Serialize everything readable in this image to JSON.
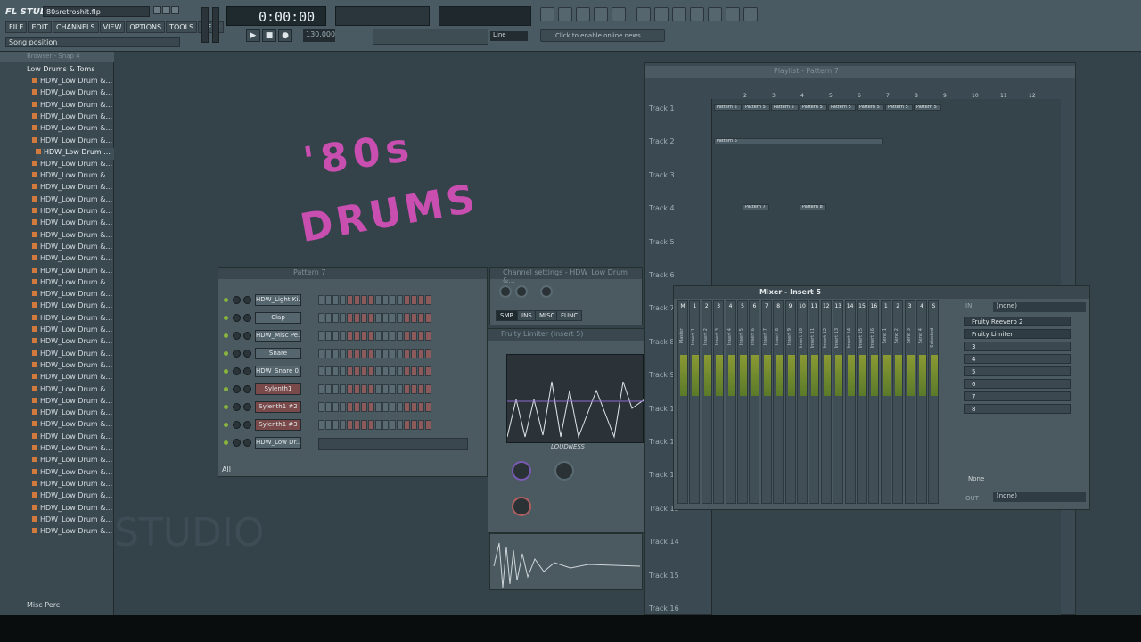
{
  "app": {
    "logo": "FL STUDIO",
    "project_file": "80sretroshit.flp",
    "hint": "Song position",
    "time": "0:00:00",
    "tempo": "130.000",
    "snap": "Line",
    "online": "Click to enable online news"
  },
  "menu": [
    "FILE",
    "EDIT",
    "CHANNELS",
    "VIEW",
    "OPTIONS",
    "TOOLS",
    "HELP"
  ],
  "browser": {
    "title": "Browser - Snap 4",
    "folder": "Low Drums & Toms",
    "selected": "HDW_Low Drum ...",
    "item_label": "HDW_Low Drum &...",
    "bottom_folder": "Misc Perc"
  },
  "overlay_text": {
    "line1": "'80s",
    "line2": "DRUMS",
    "watermark": "STUDIO"
  },
  "channel_rack": {
    "title": "Pattern 7",
    "filter": "All",
    "channels": [
      {
        "name": "HDW_Light Ki...",
        "red": false
      },
      {
        "name": "Clap",
        "red": false
      },
      {
        "name": "HDW_Misc Pe...",
        "red": false
      },
      {
        "name": "Snare",
        "red": false
      },
      {
        "name": "HDW_Snare 0...",
        "red": false
      },
      {
        "name": "Sylenth1",
        "red": true
      },
      {
        "name": "Sylenth1 #2",
        "red": true
      },
      {
        "name": "Sylenth1 #3",
        "red": true
      },
      {
        "name": "HDW_Low Dr...",
        "red": false
      }
    ]
  },
  "channel_settings": {
    "title": "Channel settings - HDW_Low Drum &...",
    "tabs": [
      "SMP",
      "INS",
      "MISC",
      "FUNC"
    ]
  },
  "limiter": {
    "title": "Fruity Limiter (Insert 5)",
    "mode_label": "LOUDNESS"
  },
  "playlist": {
    "title": "Playlist - Pattern 7",
    "tracks": [
      "Track 1",
      "Track 2",
      "Track 3",
      "Track 4",
      "Track 5",
      "Track 6",
      "Track 7",
      "Track 8",
      "Track 9",
      "Track 10",
      "Track 11",
      "Track 12",
      "Track 13",
      "Track 14",
      "Track 15",
      "Track 16"
    ],
    "ruler": [
      "2",
      "3",
      "4",
      "5",
      "6",
      "7",
      "8",
      "9",
      "10",
      "11",
      "12"
    ],
    "clip_pattern5": "Pattern 5",
    "clip_pattern6": "Pattern 6",
    "clip_pattern7": "Pattern 7",
    "clip_pattern8": "Pattern 8"
  },
  "mixer": {
    "title": "Mixer - Insert 5",
    "in_label": "IN",
    "out_label": "OUT",
    "in_value": "(none)",
    "out_value": "(none)",
    "slots": [
      "Fruity Reeverb 2",
      "Fruity Limiter",
      "3",
      "4",
      "5",
      "6",
      "7",
      "8"
    ],
    "none_label": "None",
    "strips": [
      {
        "num": "M",
        "name": "Master"
      },
      {
        "num": "1",
        "name": "Insert 1"
      },
      {
        "num": "2",
        "name": "Insert 2"
      },
      {
        "num": "3",
        "name": "Insert 3"
      },
      {
        "num": "4",
        "name": "Insert 4"
      },
      {
        "num": "5",
        "name": "Insert 5"
      },
      {
        "num": "6",
        "name": "Insert 6"
      },
      {
        "num": "7",
        "name": "Insert 7"
      },
      {
        "num": "8",
        "name": "Insert 8"
      },
      {
        "num": "9",
        "name": "Insert 9"
      },
      {
        "num": "10",
        "name": "Insert 10"
      },
      {
        "num": "11",
        "name": "Insert 11"
      },
      {
        "num": "12",
        "name": "Insert 12"
      },
      {
        "num": "13",
        "name": "Insert 13"
      },
      {
        "num": "14",
        "name": "Insert 14"
      },
      {
        "num": "15",
        "name": "Insert 15"
      },
      {
        "num": "16",
        "name": "Insert 16"
      },
      {
        "num": "1",
        "name": "Send 1"
      },
      {
        "num": "2",
        "name": "Send 2"
      },
      {
        "num": "3",
        "name": "Send 3"
      },
      {
        "num": "4",
        "name": "Send 4"
      },
      {
        "num": "S",
        "name": "Selected"
      }
    ]
  },
  "colors": {
    "accent_pink": "#c84fb0",
    "meter_green": "#8a9a33",
    "panel": "#4b5960"
  }
}
